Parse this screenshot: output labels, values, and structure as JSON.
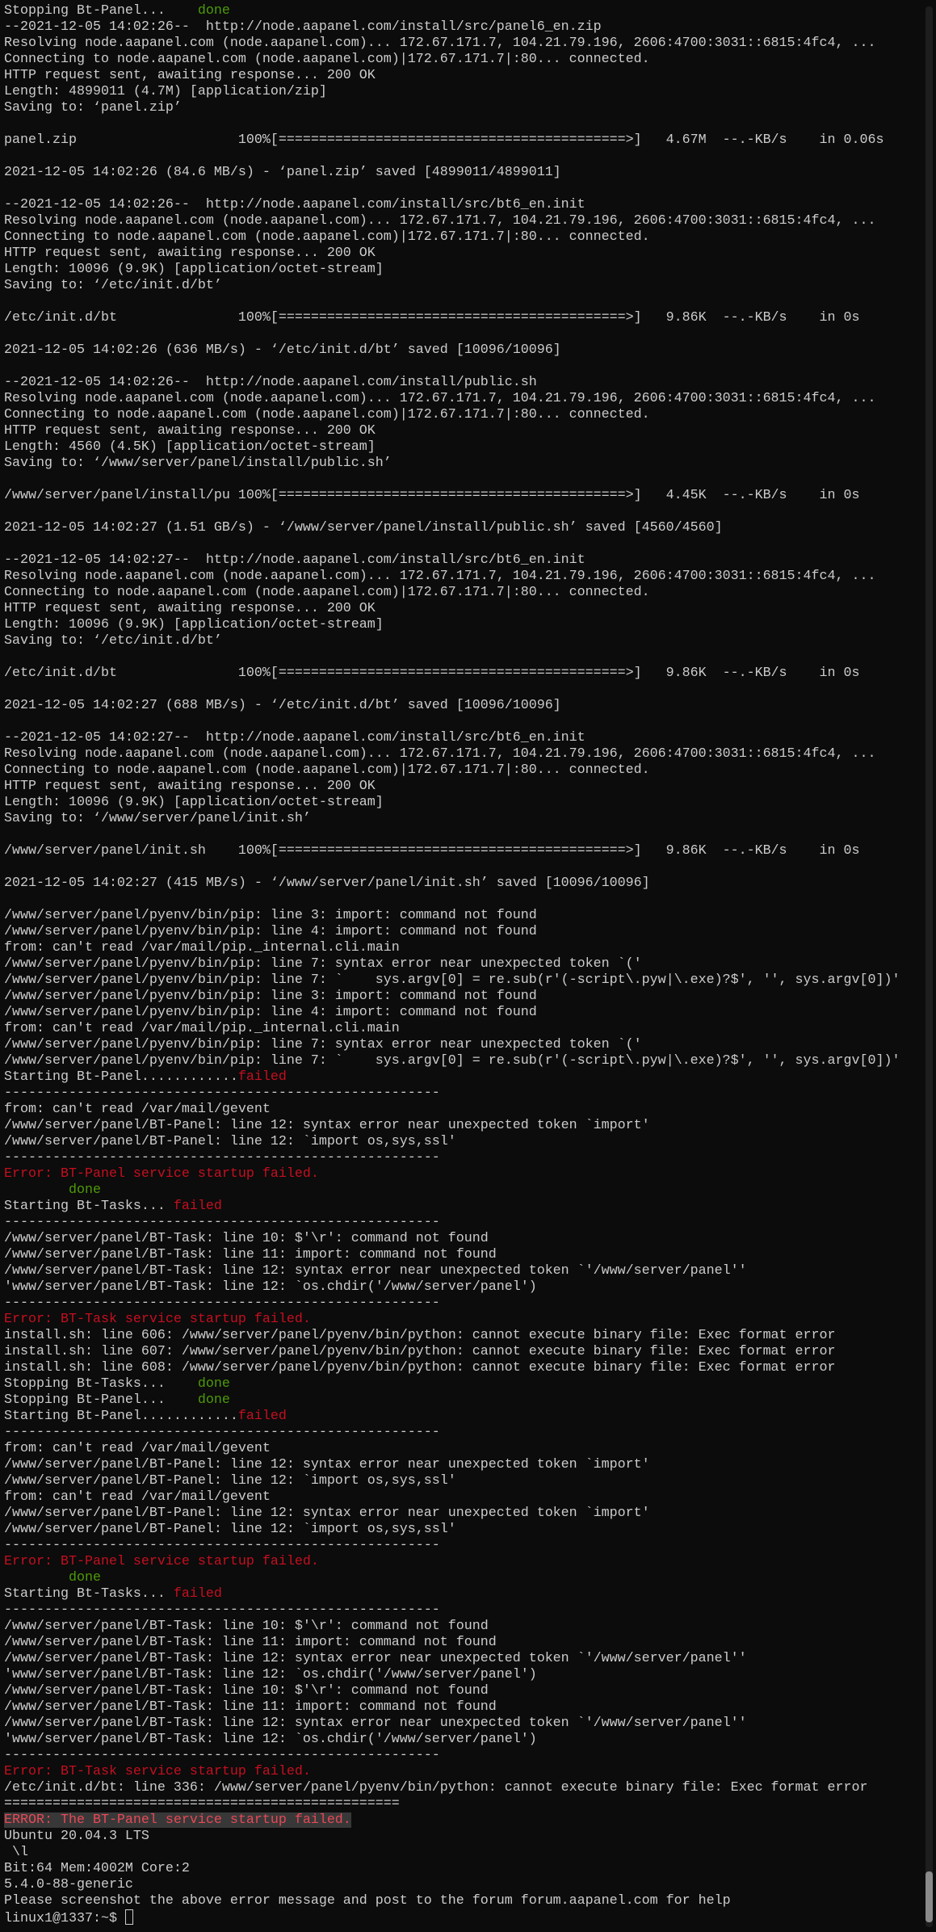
{
  "terminal": {
    "prompt": "linux1@1337:~$ ",
    "lines": [
      {
        "text": "Stopping Bt-Panel...    ",
        "tail": "done",
        "tail_class": "green"
      },
      {
        "text": "--2021-12-05 14:02:26--  http://node.aapanel.com/install/src/panel6_en.zip"
      },
      {
        "text": "Resolving node.aapanel.com (node.aapanel.com)... 172.67.171.7, 104.21.79.196, 2606:4700:3031::6815:4fc4, ..."
      },
      {
        "text": "Connecting to node.aapanel.com (node.aapanel.com)|172.67.171.7|:80... connected."
      },
      {
        "text": "HTTP request sent, awaiting response... 200 OK"
      },
      {
        "text": "Length: 4899011 (4.7M) [application/zip]"
      },
      {
        "text": "Saving to: ‘panel.zip’"
      },
      {
        "text": ""
      },
      {
        "text": "panel.zip                    100%[===========================================>]   4.67M  --.-KB/s    in 0.06s"
      },
      {
        "text": ""
      },
      {
        "text": "2021-12-05 14:02:26 (84.6 MB/s) - ‘panel.zip’ saved [4899011/4899011]"
      },
      {
        "text": ""
      },
      {
        "text": "--2021-12-05 14:02:26--  http://node.aapanel.com/install/src/bt6_en.init"
      },
      {
        "text": "Resolving node.aapanel.com (node.aapanel.com)... 172.67.171.7, 104.21.79.196, 2606:4700:3031::6815:4fc4, ..."
      },
      {
        "text": "Connecting to node.aapanel.com (node.aapanel.com)|172.67.171.7|:80... connected."
      },
      {
        "text": "HTTP request sent, awaiting response... 200 OK"
      },
      {
        "text": "Length: 10096 (9.9K) [application/octet-stream]"
      },
      {
        "text": "Saving to: ‘/etc/init.d/bt’"
      },
      {
        "text": ""
      },
      {
        "text": "/etc/init.d/bt               100%[===========================================>]   9.86K  --.-KB/s    in 0s"
      },
      {
        "text": ""
      },
      {
        "text": "2021-12-05 14:02:26 (636 MB/s) - ‘/etc/init.d/bt’ saved [10096/10096]"
      },
      {
        "text": ""
      },
      {
        "text": "--2021-12-05 14:02:26--  http://node.aapanel.com/install/public.sh"
      },
      {
        "text": "Resolving node.aapanel.com (node.aapanel.com)... 172.67.171.7, 104.21.79.196, 2606:4700:3031::6815:4fc4, ..."
      },
      {
        "text": "Connecting to node.aapanel.com (node.aapanel.com)|172.67.171.7|:80... connected."
      },
      {
        "text": "HTTP request sent, awaiting response... 200 OK"
      },
      {
        "text": "Length: 4560 (4.5K) [application/octet-stream]"
      },
      {
        "text": "Saving to: ‘/www/server/panel/install/public.sh’"
      },
      {
        "text": ""
      },
      {
        "text": "/www/server/panel/install/pu 100%[===========================================>]   4.45K  --.-KB/s    in 0s"
      },
      {
        "text": ""
      },
      {
        "text": "2021-12-05 14:02:27 (1.51 GB/s) - ‘/www/server/panel/install/public.sh’ saved [4560/4560]"
      },
      {
        "text": ""
      },
      {
        "text": "--2021-12-05 14:02:27--  http://node.aapanel.com/install/src/bt6_en.init"
      },
      {
        "text": "Resolving node.aapanel.com (node.aapanel.com)... 172.67.171.7, 104.21.79.196, 2606:4700:3031::6815:4fc4, ..."
      },
      {
        "text": "Connecting to node.aapanel.com (node.aapanel.com)|172.67.171.7|:80... connected."
      },
      {
        "text": "HTTP request sent, awaiting response... 200 OK"
      },
      {
        "text": "Length: 10096 (9.9K) [application/octet-stream]"
      },
      {
        "text": "Saving to: ‘/etc/init.d/bt’"
      },
      {
        "text": ""
      },
      {
        "text": "/etc/init.d/bt               100%[===========================================>]   9.86K  --.-KB/s    in 0s"
      },
      {
        "text": ""
      },
      {
        "text": "2021-12-05 14:02:27 (688 MB/s) - ‘/etc/init.d/bt’ saved [10096/10096]"
      },
      {
        "text": ""
      },
      {
        "text": "--2021-12-05 14:02:27--  http://node.aapanel.com/install/src/bt6_en.init"
      },
      {
        "text": "Resolving node.aapanel.com (node.aapanel.com)... 172.67.171.7, 104.21.79.196, 2606:4700:3031::6815:4fc4, ..."
      },
      {
        "text": "Connecting to node.aapanel.com (node.aapanel.com)|172.67.171.7|:80... connected."
      },
      {
        "text": "HTTP request sent, awaiting response... 200 OK"
      },
      {
        "text": "Length: 10096 (9.9K) [application/octet-stream]"
      },
      {
        "text": "Saving to: ‘/www/server/panel/init.sh’"
      },
      {
        "text": ""
      },
      {
        "text": "/www/server/panel/init.sh    100%[===========================================>]   9.86K  --.-KB/s    in 0s"
      },
      {
        "text": ""
      },
      {
        "text": "2021-12-05 14:02:27 (415 MB/s) - ‘/www/server/panel/init.sh’ saved [10096/10096]"
      },
      {
        "text": ""
      },
      {
        "text": "/www/server/panel/pyenv/bin/pip: line 3: import: command not found"
      },
      {
        "text": "/www/server/panel/pyenv/bin/pip: line 4: import: command not found"
      },
      {
        "text": "from: can't read /var/mail/pip._internal.cli.main"
      },
      {
        "text": "/www/server/panel/pyenv/bin/pip: line 7: syntax error near unexpected token `('"
      },
      {
        "text": "/www/server/panel/pyenv/bin/pip: line 7: `    sys.argv[0] = re.sub(r'(-script\\.pyw|\\.exe)?$', '', sys.argv[0])'"
      },
      {
        "text": "/www/server/panel/pyenv/bin/pip: line 3: import: command not found"
      },
      {
        "text": "/www/server/panel/pyenv/bin/pip: line 4: import: command not found"
      },
      {
        "text": "from: can't read /var/mail/pip._internal.cli.main"
      },
      {
        "text": "/www/server/panel/pyenv/bin/pip: line 7: syntax error near unexpected token `('"
      },
      {
        "text": "/www/server/panel/pyenv/bin/pip: line 7: `    sys.argv[0] = re.sub(r'(-script\\.pyw|\\.exe)?$', '', sys.argv[0])'"
      },
      {
        "text": "Starting Bt-Panel............",
        "tail": "failed",
        "tail_class": "red"
      },
      {
        "text": "------------------------------------------------------"
      },
      {
        "text": "from: can't read /var/mail/gevent"
      },
      {
        "text": "/www/server/panel/BT-Panel: line 12: syntax error near unexpected token `import'"
      },
      {
        "text": "/www/server/panel/BT-Panel: line 12: `import os,sys,ssl'"
      },
      {
        "text": "------------------------------------------------------"
      },
      {
        "text": "Error: BT-Panel service startup failed.",
        "class": "red"
      },
      {
        "text": "        done",
        "class": "green"
      },
      {
        "text": "Starting Bt-Tasks... ",
        "tail": "failed",
        "tail_class": "red"
      },
      {
        "text": "------------------------------------------------------"
      },
      {
        "text": "/www/server/panel/BT-Task: line 10: $'\\r': command not found"
      },
      {
        "text": "/www/server/panel/BT-Task: line 11: import: command not found"
      },
      {
        "text": "/www/server/panel/BT-Task: line 12: syntax error near unexpected token `'/www/server/panel''"
      },
      {
        "text": "'www/server/panel/BT-Task: line 12: `os.chdir('/www/server/panel')"
      },
      {
        "text": "------------------------------------------------------"
      },
      {
        "text": "Error: BT-Task service startup failed.",
        "class": "red"
      },
      {
        "text": "install.sh: line 606: /www/server/panel/pyenv/bin/python: cannot execute binary file: Exec format error"
      },
      {
        "text": "install.sh: line 607: /www/server/panel/pyenv/bin/python: cannot execute binary file: Exec format error"
      },
      {
        "text": "install.sh: line 608: /www/server/panel/pyenv/bin/python: cannot execute binary file: Exec format error"
      },
      {
        "text": "Stopping Bt-Tasks...    ",
        "tail": "done",
        "tail_class": "green"
      },
      {
        "text": "Stopping Bt-Panel...    ",
        "tail": "done",
        "tail_class": "green"
      },
      {
        "text": "Starting Bt-Panel............",
        "tail": "failed",
        "tail_class": "red"
      },
      {
        "text": "------------------------------------------------------"
      },
      {
        "text": "from: can't read /var/mail/gevent"
      },
      {
        "text": "/www/server/panel/BT-Panel: line 12: syntax error near unexpected token `import'"
      },
      {
        "text": "/www/server/panel/BT-Panel: line 12: `import os,sys,ssl'"
      },
      {
        "text": "from: can't read /var/mail/gevent"
      },
      {
        "text": "/www/server/panel/BT-Panel: line 12: syntax error near unexpected token `import'"
      },
      {
        "text": "/www/server/panel/BT-Panel: line 12: `import os,sys,ssl'"
      },
      {
        "text": "------------------------------------------------------"
      },
      {
        "text": "Error: BT-Panel service startup failed.",
        "class": "red"
      },
      {
        "text": "        done",
        "class": "green"
      },
      {
        "text": "Starting Bt-Tasks... ",
        "tail": "failed",
        "tail_class": "red"
      },
      {
        "text": "------------------------------------------------------"
      },
      {
        "text": "/www/server/panel/BT-Task: line 10: $'\\r': command not found"
      },
      {
        "text": "/www/server/panel/BT-Task: line 11: import: command not found"
      },
      {
        "text": "/www/server/panel/BT-Task: line 12: syntax error near unexpected token `'/www/server/panel''"
      },
      {
        "text": "'www/server/panel/BT-Task: line 12: `os.chdir('/www/server/panel')"
      },
      {
        "text": "/www/server/panel/BT-Task: line 10: $'\\r': command not found"
      },
      {
        "text": "/www/server/panel/BT-Task: line 11: import: command not found"
      },
      {
        "text": "/www/server/panel/BT-Task: line 12: syntax error near unexpected token `'/www/server/panel''"
      },
      {
        "text": "'www/server/panel/BT-Task: line 12: `os.chdir('/www/server/panel')"
      },
      {
        "text": "------------------------------------------------------"
      },
      {
        "text": "Error: BT-Task service startup failed.",
        "class": "red"
      },
      {
        "text": "/etc/init.d/bt: line 336: /www/server/panel/pyenv/bin/python: cannot execute binary file: Exec format error"
      },
      {
        "text": "================================================="
      },
      {
        "text": "ERROR: The BT-Panel service startup failed.",
        "class": "err"
      },
      {
        "text": "Ubuntu 20.04.3 LTS"
      },
      {
        "text": " \\l"
      },
      {
        "text": "Bit:64 Mem:4002M Core:2"
      },
      {
        "text": "5.4.0-88-generic"
      },
      {
        "text": "Please screenshot the above error message and post to the forum forum.aapanel.com for help"
      }
    ]
  },
  "colors": {
    "background": "#0c0c0c",
    "foreground": "#cccccc",
    "red": "#c50f1f",
    "green": "#4e9a06",
    "error_highlight": "#e74856"
  }
}
